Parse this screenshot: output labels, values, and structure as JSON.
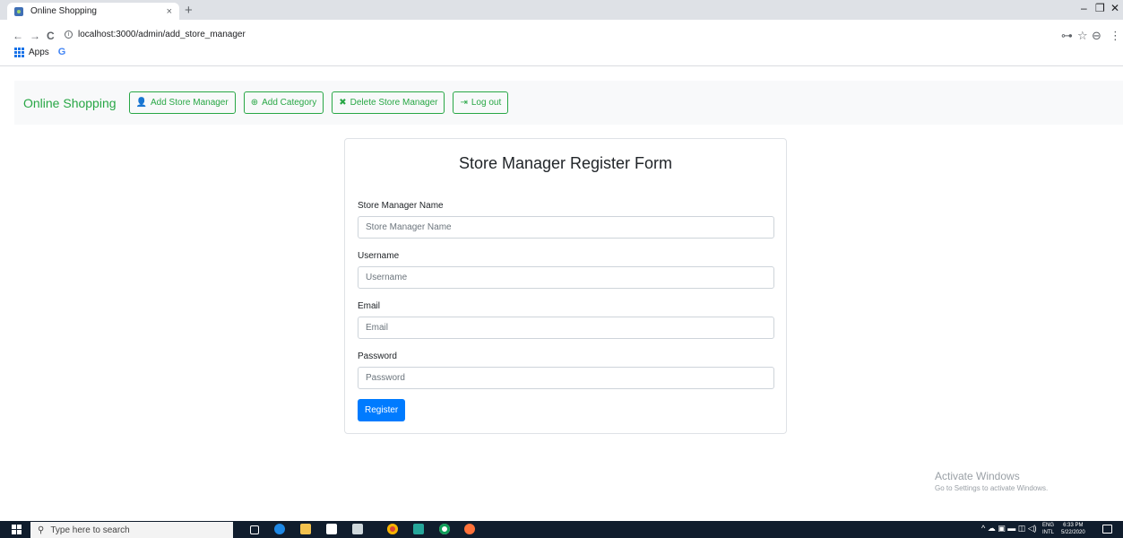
{
  "browser": {
    "tab_title": "Online Shopping",
    "tab_close": "×",
    "new_tab": "+",
    "url": "localhost:3000/admin/add_store_manager",
    "bookmarks": {
      "apps_label": "Apps",
      "google_label": "G"
    },
    "window_controls": {
      "minimize": "–",
      "restore": "❐",
      "close": "✕"
    },
    "icons": {
      "back": "←",
      "forward": "→",
      "reload": "C",
      "info": "i",
      "key": "⊶",
      "star": "☆",
      "profile": "⊖",
      "menu": "⋮"
    }
  },
  "navbar": {
    "brand": "Online Shopping",
    "buttons": [
      {
        "label": "Add Store Manager",
        "icon": "user-plus-icon",
        "glyph": "👤"
      },
      {
        "label": "Add Category",
        "icon": "plus-circle-icon",
        "glyph": "⊕"
      },
      {
        "label": "Delete Store Manager",
        "icon": "user-slash-icon",
        "glyph": "✖"
      },
      {
        "label": "Log out",
        "icon": "sign-out-icon",
        "glyph": "⇥"
      }
    ]
  },
  "form": {
    "title": "Store Manager Register Form",
    "fields": [
      {
        "label": "Store Manager Name",
        "placeholder": "Store Manager Name",
        "value": ""
      },
      {
        "label": "Username",
        "placeholder": "Username",
        "value": ""
      },
      {
        "label": "Email",
        "placeholder": "Email",
        "value": ""
      },
      {
        "label": "Password",
        "placeholder": "Password",
        "value": ""
      }
    ],
    "submit_label": "Register"
  },
  "watermark": {
    "title": "Activate Windows",
    "subtitle": "Go to Settings to activate Windows."
  },
  "taskbar": {
    "search_placeholder": "Type here to search",
    "search_icon": "⚲",
    "lang_top": "ENG",
    "lang_bottom": "INTL",
    "time": "6:33 PM",
    "date": "5/22/2020",
    "tray_glyphs": "^ ☁ ▣ ▬ ◫ ◁)"
  },
  "colors": {
    "brand_green": "#28a745",
    "primary_blue": "#007bff",
    "taskbar_bg": "#101d2d",
    "navbar_bg": "#f8f9fa"
  }
}
